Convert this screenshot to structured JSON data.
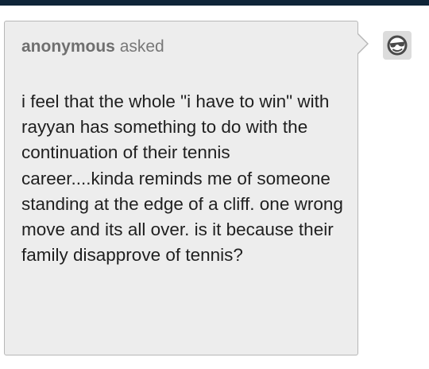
{
  "ask": {
    "asker_name": "anonymous",
    "asked_label": "asked",
    "question": "i feel that the whole \"i have to win\" with rayyan has something to do with the continuation of their tennis career....kinda reminds me of someone standing at the edge of a cliff. one wrong move and its all over. is it because their family disapprove of tennis?"
  },
  "avatar": {
    "icon": "anonymous-sunglasses-face-icon"
  },
  "colors": {
    "top_bar": "#0f2538",
    "card_background": "#ededed",
    "card_border": "#b7b7b7",
    "question_text": "#1f1f1f",
    "asker_text": "#787878"
  }
}
